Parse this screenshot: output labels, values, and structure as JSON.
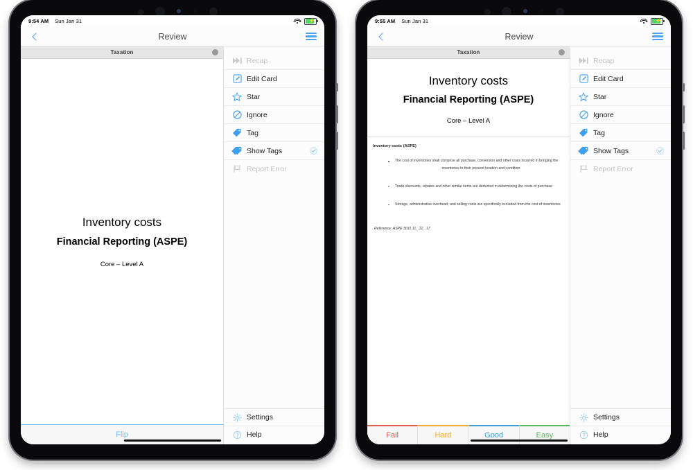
{
  "app": {
    "nav_title": "Review",
    "back_icon": "chevron-left-icon",
    "menu_icon": "hamburger-menu-icon",
    "deck_label": "Taxation",
    "accent_blue": "#4da2f5"
  },
  "devices": [
    {
      "id": "left",
      "status": {
        "time": "9:54 AM",
        "date": "Sun Jan 31",
        "wifi_icon": "wifi-icon",
        "battery_icon": "battery-charging-icon"
      },
      "card_side": "front",
      "footer": {
        "type": "flip",
        "label": "Flip"
      }
    },
    {
      "id": "right",
      "status": {
        "time": "9:55 AM",
        "date": "Sun Jan 31",
        "wifi_icon": "wifi-icon",
        "battery_icon": "battery-charging-icon"
      },
      "card_side": "back",
      "footer": {
        "type": "grade",
        "buttons": [
          {
            "label": "Fail",
            "color": "#e05a4e"
          },
          {
            "label": "Hard",
            "color": "#efa935"
          },
          {
            "label": "Good",
            "color": "#3aa0d8"
          },
          {
            "label": "Easy",
            "color": "#5cb85c"
          }
        ]
      }
    }
  ],
  "card": {
    "title": "Inventory costs",
    "subtitle": "Financial Reporting (ASPE)",
    "meta": "Core – Level A",
    "answer": {
      "heading": "Inventory costs (ASPE)",
      "bullets": [
        {
          "line1": "The cost of inventories shall comprise all purchase, conversion and other costs incurred in bringing the",
          "line2": "inventories to their present location and condition"
        },
        {
          "line1": "Trade discounts, rebates and other similar items are deducted in determining the costs of purchase",
          "line2": ""
        },
        {
          "line1": "Storage, administrative overhead, and selling costs are specifically excluded from the cost of inventories",
          "line2": ""
        }
      ],
      "reference": "Reference: ASPE 3031.11, .12, .17"
    }
  },
  "menu": {
    "items": [
      {
        "label": "Recap",
        "icon": "fast-forward-icon",
        "disabled": true,
        "checked": false
      },
      {
        "label": "Edit Card",
        "icon": "edit-square-icon",
        "disabled": false,
        "checked": false
      },
      {
        "label": "Star",
        "icon": "star-icon",
        "disabled": false,
        "checked": false
      },
      {
        "label": "Ignore",
        "icon": "ban-icon",
        "disabled": false,
        "checked": false
      },
      {
        "label": "Tag",
        "icon": "tag-icon",
        "disabled": false,
        "checked": false
      },
      {
        "label": "Show Tags",
        "icon": "tags-icon",
        "disabled": false,
        "checked": true
      },
      {
        "label": "Report Error",
        "icon": "flag-icon",
        "disabled": true,
        "checked": false
      }
    ],
    "bottom_items": [
      {
        "label": "Settings",
        "icon": "gear-icon"
      },
      {
        "label": "Help",
        "icon": "question-circle-icon"
      }
    ]
  }
}
